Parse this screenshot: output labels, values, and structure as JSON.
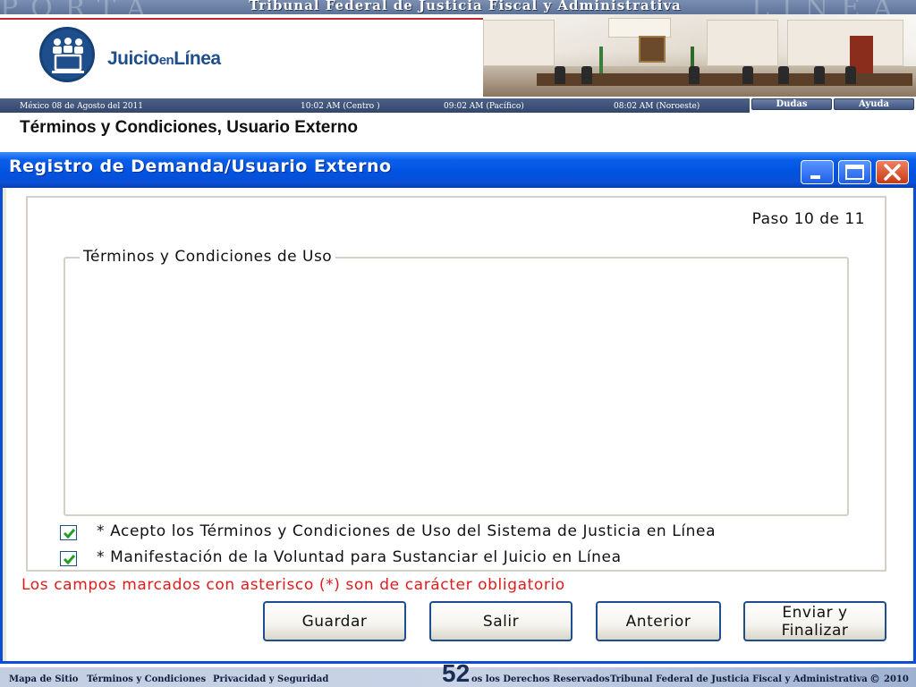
{
  "banner": {
    "title": "Tribunal Federal de Justicia Fiscal y Administrativa",
    "watermark_left": "PORTA",
    "watermark_right": "LINEA"
  },
  "logo": {
    "part1": "Juicio",
    "part2": "en",
    "part3": "Línea",
    "icon": "people-at-computer-icon",
    "color": "#1e4f8c"
  },
  "courtroom_plaque": "Tribunal Federal de Justicia Fiscal y Administrativa",
  "infobar": {
    "date": "México 08 de Agosto del 2011",
    "time_centro": "10:02  AM (Centro )",
    "time_pacifico": "09:02 AM  (Pacífico)",
    "time_noroeste": "08:02 AM (Noroeste)",
    "dudas_label": "Dudas",
    "ayuda_label": "Ayuda"
  },
  "page_title": "Términos y Condiciones, Usuario Externo",
  "window": {
    "title": "Registro de Demanda/Usuario Externo",
    "accent": "#0a4fd6",
    "close_color": "#c83a14",
    "step": "Paso 10 de 11",
    "terms_legend": "Términos y Condiciones de Uso",
    "checkboxes": [
      {
        "label": "* Acepto los Términos y Condiciones de Uso del Sistema de Justicia en Línea",
        "checked": true
      },
      {
        "label": "* Manifestación de la Voluntad para Sustanciar el Juicio en Línea",
        "checked": true
      }
    ],
    "required_note": "Los campos marcados con asterisco (*) son de carácter obligatorio",
    "required_color": "#e11b1b",
    "buttons": {
      "guardar": "Guardar",
      "salir": "Salir",
      "anterior": "Anterior",
      "enviar_line1": "Enviar y",
      "enviar_line2": "Finalizar"
    }
  },
  "footer": {
    "mapa": "Mapa de Sitio",
    "terminos": "Términos y Condiciones",
    "privacidad": "Privacidad y Seguridad",
    "derechos": "os los Derechos Reservados",
    "tribunal": "Tribunal Federal de Justicia Fiscal y Administrativa",
    "copyright": "©",
    "year": "2010",
    "slide_number": "52"
  }
}
